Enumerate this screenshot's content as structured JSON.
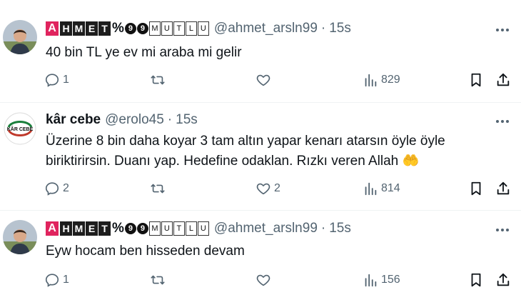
{
  "tweets": [
    {
      "name_styled": {
        "a": "A",
        "boxes": [
          "H",
          "M",
          "E",
          "T"
        ],
        "pct": "%",
        "circles": [
          "9",
          "9"
        ],
        "outline": [
          "M",
          "U",
          "T",
          "L",
          "U"
        ]
      },
      "handle": "@ahmet_arsln99",
      "dot": "·",
      "time": "15s",
      "text": "40 bin TL ye ev mi araba mi gelir",
      "reply_count": "1",
      "retweet_count": "",
      "like_count": "",
      "view_count": "829"
    },
    {
      "name": "kâr cebe",
      "handle": "@erolo45",
      "dot": "·",
      "time": "15s",
      "text_line1": "Üzerine 8 bin daha koyar 3 tam altın yapar kenarı atarsın öyle öyle",
      "text_line2": "biriktirirsin. Duanı yap. Hedefine odaklan. Rızkı veren Allah",
      "emoji": "🤲",
      "avatar_text": "KÂR CEBE",
      "reply_count": "2",
      "retweet_count": "",
      "like_count": "2",
      "view_count": "814"
    },
    {
      "name_styled": {
        "a": "A",
        "boxes": [
          "H",
          "M",
          "E",
          "T"
        ],
        "pct": "%",
        "circles": [
          "9",
          "9"
        ],
        "outline": [
          "M",
          "U",
          "T",
          "L",
          "U"
        ]
      },
      "handle": "@ahmet_arsln99",
      "dot": "·",
      "time": "15s",
      "text": "Eyw hocam ben hisseden devam",
      "reply_count": "1",
      "retweet_count": "",
      "like_count": "",
      "view_count": "156"
    }
  ],
  "colors": {
    "muted": "#536471",
    "accent_red": "#e0245e",
    "emoji_gold": "#f5c542"
  }
}
